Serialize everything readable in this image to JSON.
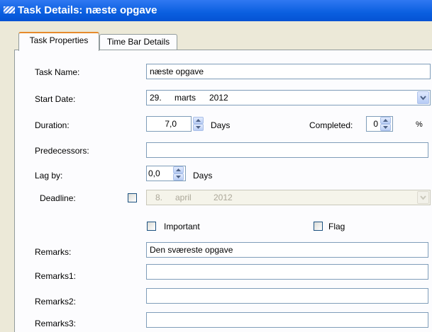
{
  "window": {
    "title": "Task Details: næste opgave"
  },
  "tabs": [
    {
      "label": "Task Properties",
      "active": true
    },
    {
      "label": "Time Bar Details",
      "active": false
    }
  ],
  "form": {
    "task_name": {
      "label": "Task Name:",
      "value": "næste opgave"
    },
    "start_date": {
      "label": "Start Date:",
      "day": "29.",
      "month": "marts",
      "year": "2012"
    },
    "duration": {
      "label": "Duration:",
      "value": "7,0",
      "unit": "Days"
    },
    "completed": {
      "label": "Completed:",
      "value": "0",
      "unit": "%"
    },
    "predecessors": {
      "label": "Predecessors:",
      "value": ""
    },
    "lag_by": {
      "label": "Lag by:",
      "value": "0,0",
      "unit": "Days"
    },
    "deadline": {
      "label": "Deadline:",
      "checked": false,
      "day": "8.",
      "month": "april",
      "year": "2012"
    },
    "important": {
      "label": "Important",
      "checked": false
    },
    "flag": {
      "label": "Flag",
      "checked": false
    },
    "remarks": {
      "label": "Remarks:",
      "value": "Den sværeste opgave"
    },
    "remarks1": {
      "label": "Remarks1:",
      "value": ""
    },
    "remarks2": {
      "label": "Remarks2:",
      "value": ""
    },
    "remarks3": {
      "label": "Remarks3:",
      "value": ""
    }
  },
  "colors": {
    "titlebar": "#0a5fe0",
    "tab_highlight": "#e68b2c",
    "field_border": "#7f9db9"
  }
}
